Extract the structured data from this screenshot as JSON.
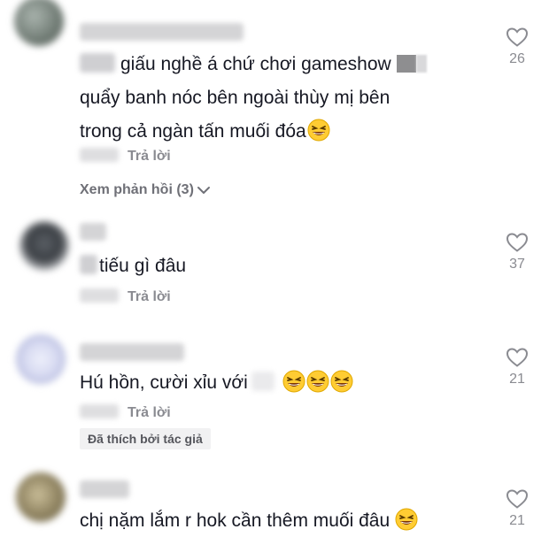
{
  "reply_label": "Trả lời",
  "comments": [
    {
      "text_line1": "giấu nghề á chứ chơi gameshow",
      "text_line2": "quẩy banh nóc bên ngoài thùy mị bên",
      "text_line3": "trong cả ngàn tấn muối đóa",
      "like_count": "26",
      "view_replies": "Xem phản hồi (3)"
    },
    {
      "text": "tiếu gì đâu",
      "like_count": "37"
    },
    {
      "text": "Hú hồn, cười xỉu với",
      "like_count": "21",
      "creator_badge": "Đã thích bởi tác giả"
    },
    {
      "text": "chị nặm lắm r hok cần thêm muối đâu",
      "like_count": "21"
    }
  ],
  "colors": {
    "text": "#161823",
    "secondary": "#8a8b91",
    "badge_bg": "#f1f1f2"
  }
}
